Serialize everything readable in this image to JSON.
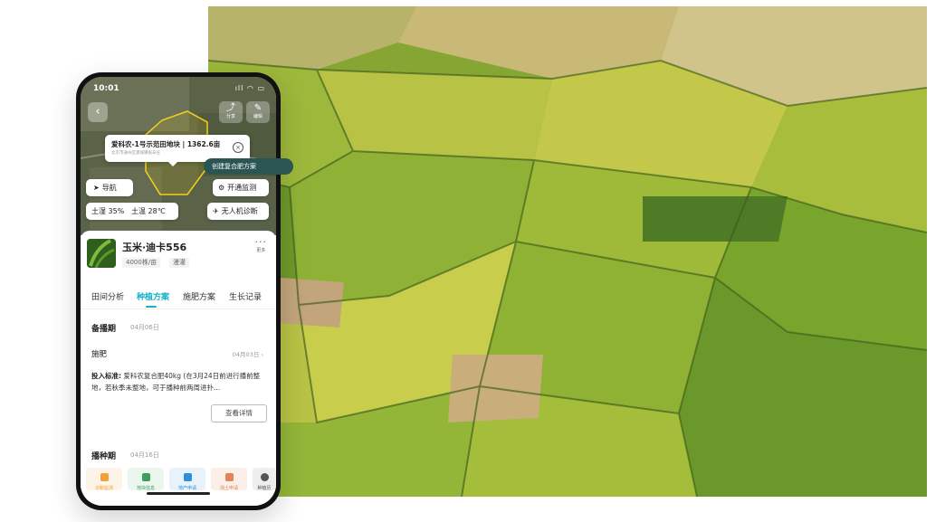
{
  "status_bar": {
    "time": "10:01",
    "indicators": "ıll ◠ ▭"
  },
  "map": {
    "back_icon": "chevron-left-icon",
    "share": {
      "icon": "share-icon",
      "label": "分享"
    },
    "edit": {
      "icon": "pencil-icon",
      "label": "编辑"
    },
    "field_name": "爱科农-1号示范田地块",
    "field_area": "1362.6亩",
    "field_address": "北京市通州区潞城镇张辛庄",
    "navigate_label": "导航",
    "monitor_label": "开通监测",
    "soil_moisture": "土湿 35%",
    "soil_temp": "土温 28℃",
    "drone_label": "无人机诊断"
  },
  "crop": {
    "name": "玉米·迪卡556",
    "density": "4000株/亩",
    "irrigation": "漫灌",
    "more_label": "更多"
  },
  "tabs": [
    {
      "label": "田间分析",
      "active": false
    },
    {
      "label": "种植方案",
      "active": true
    },
    {
      "label": "施肥方案",
      "active": false
    },
    {
      "label": "生长记录",
      "active": false
    }
  ],
  "stages": {
    "prep": {
      "title": "备播期",
      "date": "04月06日"
    },
    "create_plan_label": "创建复合肥方案",
    "fertilize": {
      "title": "施肥",
      "date": "04月03日 ›"
    },
    "standard_label": "投入标准:",
    "standard_text": "爱科农复合肥40kg (在3月24日前进行播前整地，若秋季未整地，可于播种前两周进扑...",
    "detail_label": "查看详情",
    "sowing": {
      "title": "播种期",
      "date": "04月16日"
    }
  },
  "bottom_nav": [
    {
      "label": "诊断监测",
      "color": "#f0a13c"
    },
    {
      "label": "地块信息",
      "color": "#3aa05a"
    },
    {
      "label": "地产申请",
      "color": "#2e8fd8"
    },
    {
      "label": "测土申请",
      "color": "#e0855a"
    },
    {
      "label": "种植历",
      "color": "#555555"
    }
  ],
  "colors": {
    "accent": "#16b0c8",
    "button_dark": "#2a5552",
    "field_green": "#7fa02a"
  }
}
